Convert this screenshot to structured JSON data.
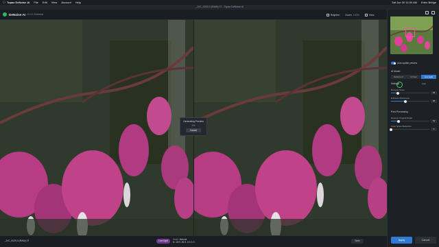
{
  "menubar": {
    "app": "Topaz DeNoise AI",
    "items": [
      "File",
      "Edit",
      "View",
      "Account",
      "Help"
    ],
    "clock": "Sat Jan 30  11:00 AM",
    "user": "Eden Bridge"
  },
  "window": {
    "title": "_JVC_0029-3 (RAW) 07 - Topaz DeNoise AI"
  },
  "header": {
    "app_name": "DeNoise AI",
    "version": "v3.4.1 External",
    "brighten": "Brighten",
    "zoom_label": "Zoom",
    "zoom_value": "100%",
    "view_label": "View"
  },
  "dialog": {
    "title": "Generating Preview",
    "progress": "1%",
    "cancel": "Cancel"
  },
  "bottom": {
    "filename": "_JVC_0029-3 (RAW) 07",
    "mode_badge": "Low Light",
    "mode_line1_key": "Mode:",
    "mode_line1_val": "Manual",
    "mode_line2": "N: 18   R: 38   S: 19   O: 0",
    "save": "Save"
  },
  "panel": {
    "auto_update": "Auto update preview",
    "ai_model": "AI Model",
    "models": [
      "DeNoise AI",
      "AI Clear",
      "Low Light"
    ],
    "active_model": 2,
    "settings": "Settings",
    "auto": "Auto",
    "sliders": [
      {
        "label": "Remove Noise",
        "value": "18",
        "fraction": 0.18
      },
      {
        "label": "Enhance Sharpness",
        "value": "38",
        "fraction": 0.38
      }
    ],
    "post": "Post-Processing",
    "post_sliders": [
      {
        "label": "Recover Original Detail",
        "value": "19",
        "fraction": 0.19
      },
      {
        "label": "Color Noise Reduction",
        "value": "0",
        "fraction": 0.0
      }
    ],
    "apply": "Apply",
    "export": "Cancel"
  },
  "colors": {
    "accent": "#2f7bd6",
    "mode_badge": "#6e3a8a",
    "flower": "#c23e8a",
    "foliage": "#3c4a33"
  }
}
